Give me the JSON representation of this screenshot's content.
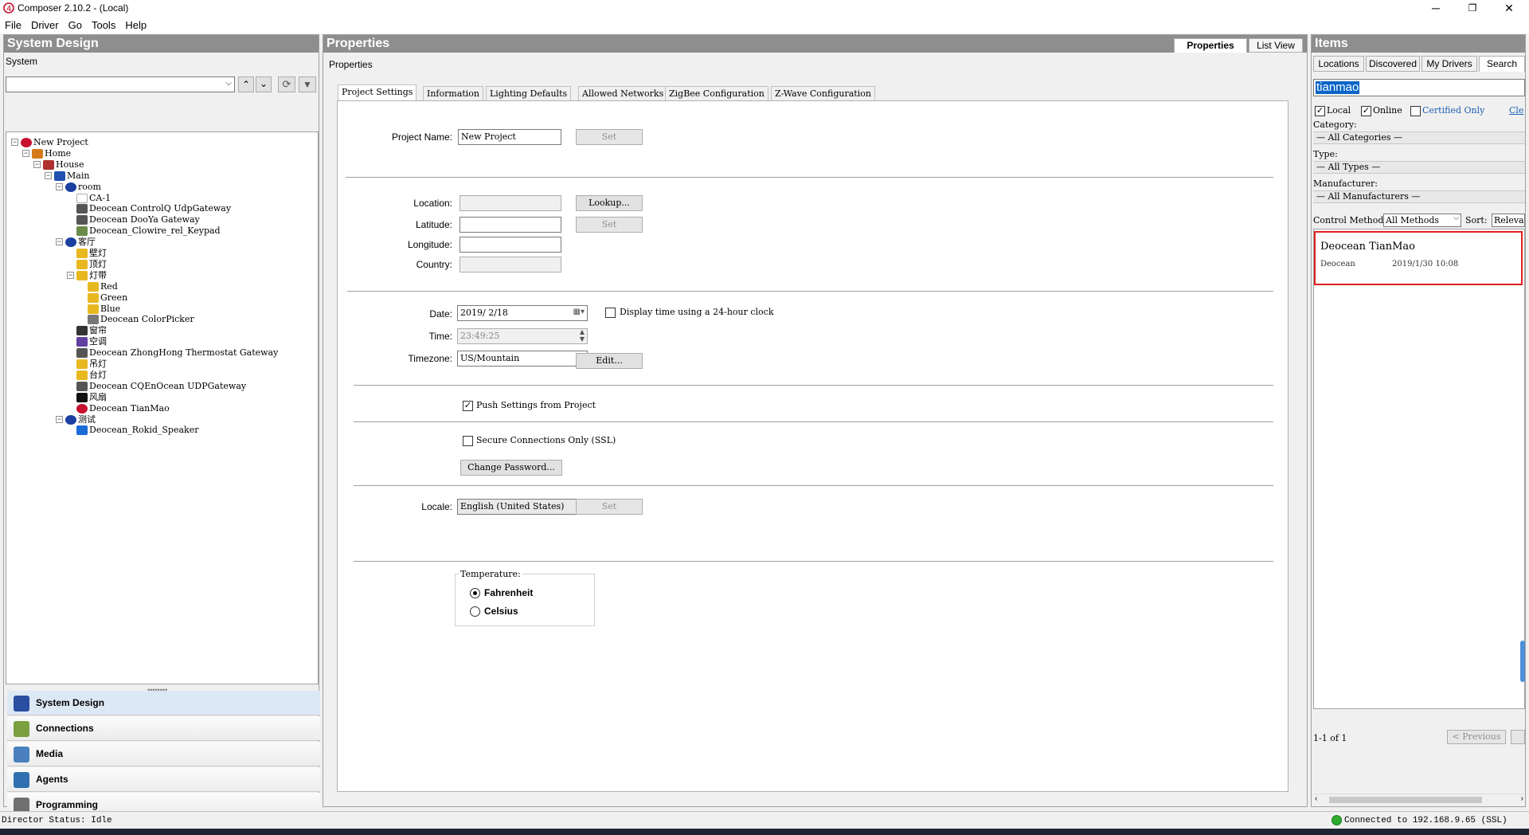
{
  "window": {
    "title": "Composer 2.10.2 - (Local)",
    "minimize": "─",
    "maximize": "❐",
    "close": "✕"
  },
  "menu": [
    "File",
    "Driver",
    "Go",
    "Tools",
    "Help"
  ],
  "left_panel": {
    "header": "System Design",
    "system_label": "System",
    "tree": [
      {
        "label": "New Project",
        "depth": 0,
        "icon": "project-icon"
      },
      {
        "label": "Home",
        "depth": 1,
        "icon": "home-icon"
      },
      {
        "label": "House",
        "depth": 2,
        "icon": "house-icon"
      },
      {
        "label": "Main",
        "depth": 3,
        "icon": "floor-icon"
      },
      {
        "label": "room",
        "depth": 4,
        "icon": "room-icon"
      },
      {
        "label": "CA-1",
        "depth": 5,
        "icon": "controller-icon"
      },
      {
        "label": "Deocean ControlQ UdpGateway",
        "depth": 5,
        "icon": "gateway-icon"
      },
      {
        "label": "Deocean DooYa Gateway",
        "depth": 5,
        "icon": "gateway-icon"
      },
      {
        "label": "Deocean_Clowire_rel_Keypad",
        "depth": 5,
        "icon": "keypad-icon"
      },
      {
        "label": "客厅",
        "depth": 4,
        "icon": "room-icon"
      },
      {
        "label": "壁灯",
        "depth": 5,
        "icon": "light-icon"
      },
      {
        "label": "顶灯",
        "depth": 5,
        "icon": "light-icon"
      },
      {
        "label": "灯带",
        "depth": 5,
        "icon": "light-icon"
      },
      {
        "label": "Red",
        "depth": 6,
        "icon": "light-icon"
      },
      {
        "label": "Green",
        "depth": 6,
        "icon": "light-icon"
      },
      {
        "label": "Blue",
        "depth": 6,
        "icon": "light-icon"
      },
      {
        "label": "Deocean ColorPicker",
        "depth": 6,
        "icon": "colorpicker-icon"
      },
      {
        "label": "窗帘",
        "depth": 5,
        "icon": "blind-icon"
      },
      {
        "label": "空调",
        "depth": 5,
        "icon": "thermostat-icon"
      },
      {
        "label": "Deocean ZhongHong Thermostat Gateway",
        "depth": 5,
        "icon": "gateway-icon"
      },
      {
        "label": "吊灯",
        "depth": 5,
        "icon": "light-icon"
      },
      {
        "label": "台灯",
        "depth": 5,
        "icon": "light-icon"
      },
      {
        "label": "Deocean CQEnOcean UDPGateway",
        "depth": 5,
        "icon": "gateway-icon"
      },
      {
        "label": "风扇",
        "depth": 5,
        "icon": "fan-icon"
      },
      {
        "label": "Deocean TianMao",
        "depth": 5,
        "icon": "tianmao-icon"
      },
      {
        "label": "测试",
        "depth": 4,
        "icon": "room-icon"
      },
      {
        "label": "Deocean_Rokid_Speaker",
        "depth": 5,
        "icon": "speaker-icon"
      }
    ],
    "nav": [
      {
        "label": "System Design",
        "icon": "system-design-icon"
      },
      {
        "label": "Connections",
        "icon": "connections-icon"
      },
      {
        "label": "Media",
        "icon": "media-icon"
      },
      {
        "label": "Agents",
        "icon": "agents-icon"
      },
      {
        "label": "Programming",
        "icon": "programming-icon"
      }
    ]
  },
  "center_panel": {
    "header": "Properties",
    "header_tabs": [
      "Properties",
      "List View"
    ],
    "sub_label": "Properties",
    "tabs": [
      "Project Settings",
      "Information",
      "Lighting Defaults",
      "Allowed Networks",
      "ZigBee Configuration",
      "Z-Wave Configuration"
    ],
    "project_name_label": "Project Name:",
    "project_name": "New Project",
    "set_label": "Set",
    "location_label": "Location:",
    "latitude_label": "Latitude:",
    "longitude_label": "Longitude:",
    "country_label": "Country:",
    "lookup_label": "Lookup...",
    "date_label": "Date:",
    "date_value": "2019/ 2/18",
    "clock24_label": "Display time using a 24-hour clock",
    "time_label": "Time:",
    "time_value": "23:49:25",
    "timezone_label": "Timezone:",
    "timezone_value": "US/Mountain",
    "edit_label": "Edit...",
    "push_settings_label": "Push Settings from Project",
    "ssl_label": "Secure Connections Only (SSL)",
    "change_password_label": "Change Password...",
    "locale_label": "Locale:",
    "locale_value": "English (United States)",
    "temperature_label": "Temperature:",
    "fahrenheit_label": "Fahrenheit",
    "celsius_label": "Celsius"
  },
  "right_panel": {
    "header": "Items",
    "tabs": [
      "Locations",
      "Discovered",
      "My Drivers",
      "Search"
    ],
    "search_value": "tianmao",
    "local_label": "Local",
    "online_label": "Online",
    "certified_label": "Certified Only",
    "clear_label": "Cle",
    "category_label": "Category:",
    "all_categories": "— All Categories —",
    "type_label": "Type:",
    "all_types": "— All Types —",
    "manufacturer_label": "Manufacturer:",
    "all_manufacturers": "— All Manufacturers —",
    "control_method_label": "Control Method",
    "control_method_value": "All Methods",
    "sort_label": "Sort:",
    "sort_value": "Relevan",
    "result": {
      "name": "Deocean TianMao",
      "manufacturer": "Deocean",
      "date": "2019/1/30 10:08"
    },
    "paging": "1-1 of 1",
    "previous_label": "< Previous"
  },
  "status": {
    "director": "Director Status: Idle",
    "connection": "Connected to 192.168.9.65 (SSL)"
  },
  "colors": {
    "panel_header": "#8e8e8e",
    "highlight_box": "#e02020",
    "selection": "#0a64c8"
  }
}
